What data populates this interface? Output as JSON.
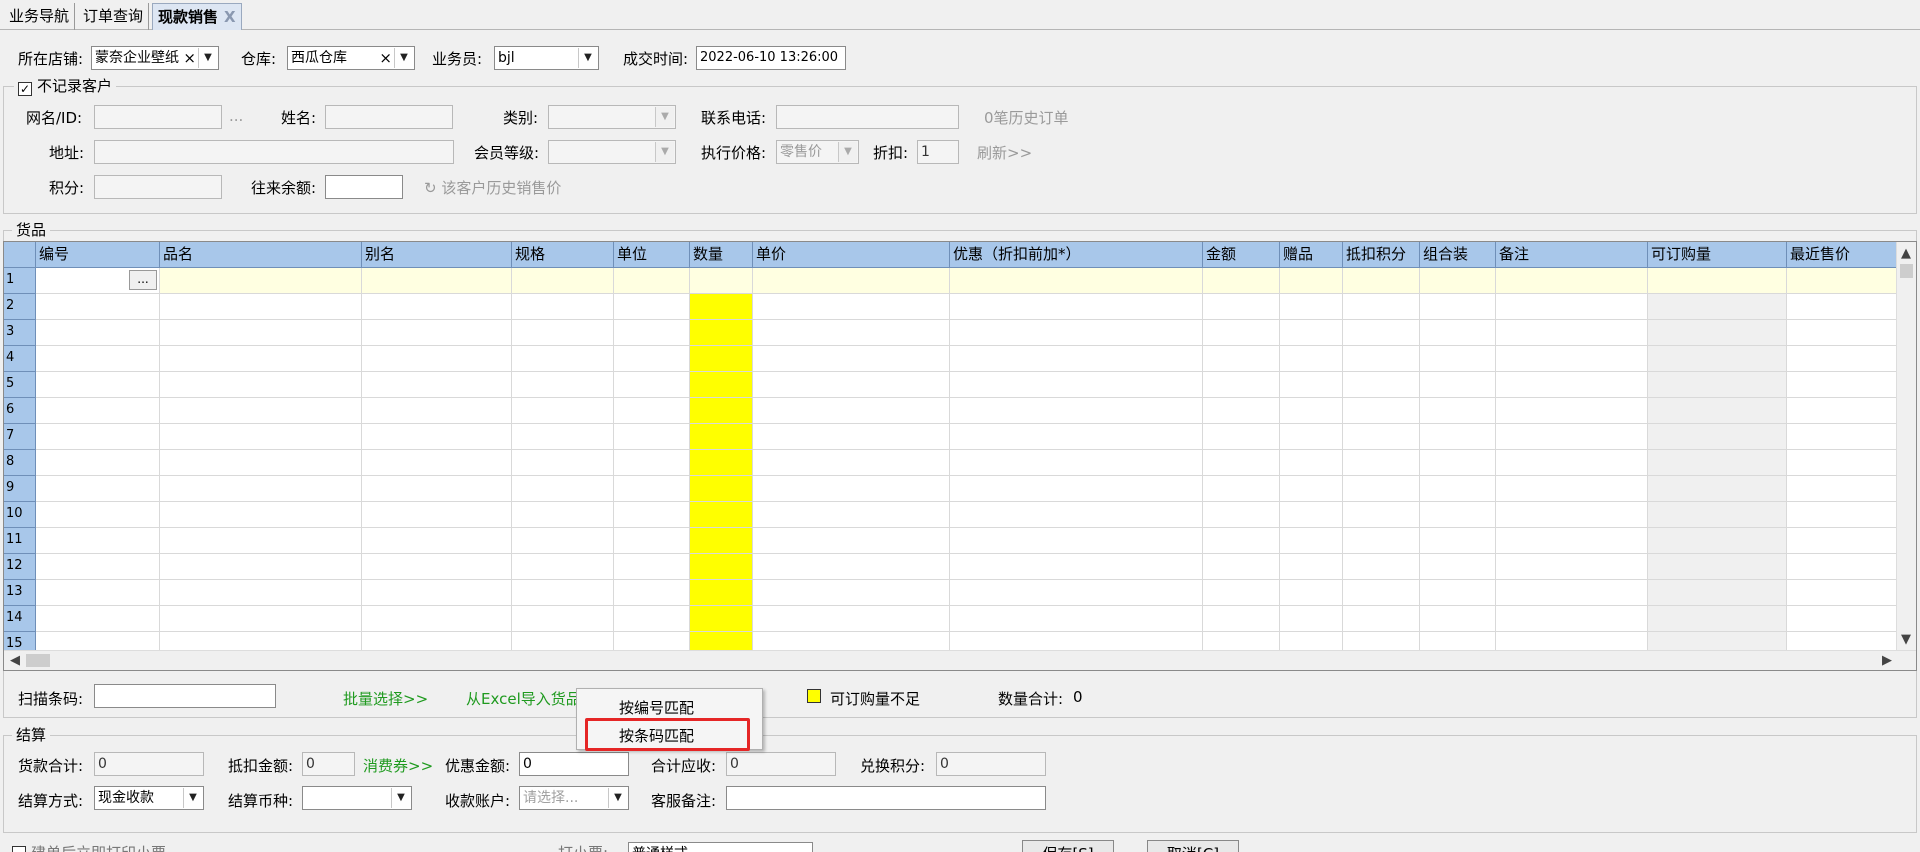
{
  "tabs": [
    {
      "label": "业务导航"
    },
    {
      "label": "订单查询"
    },
    {
      "label": "现款销售",
      "close": "X"
    }
  ],
  "header": {
    "store_label": "所在店铺:",
    "store_value": "蒙奈企业壁纸",
    "warehouse_label": "仓库:",
    "warehouse_value": "西瓜仓库",
    "salesman_label": "业务员:",
    "salesman_value": "bjl",
    "time_label": "成交时间:",
    "time_value": "2022-06-10 13:26:00"
  },
  "customer": {
    "no_record_label": "不记录客户",
    "no_record_checked": true,
    "netname_label": "网名/ID:",
    "ellipsis": "...",
    "name_label": "姓名:",
    "category_label": "类别:",
    "phone_label": "联系电话:",
    "history_orders": "0笔历史订单",
    "address_label": "地址:",
    "member_level_label": "会员等级:",
    "price_label": "执行价格:",
    "price_value": "零售价",
    "discount_label": "折扣:",
    "discount_value": "1",
    "refresh_link": "刷新>>",
    "points_label": "积分:",
    "balance_label": "往来余额:",
    "history_price_link": "该客户历史销售价"
  },
  "goods": {
    "title": "货品",
    "columns": [
      "编号",
      "品名",
      "别名",
      "规格",
      "单位",
      "数量",
      "单价",
      "优惠（折扣前加*）",
      "金额",
      "赠品",
      "抵扣积分",
      "组合装",
      "备注",
      "可订购量",
      "最近售价"
    ],
    "rows": [
      "1",
      "2",
      "3",
      "4",
      "5",
      "6",
      "7",
      "8",
      "9",
      "10",
      "11",
      "12",
      "13",
      "14",
      "15"
    ],
    "ellipsis_btn": "...",
    "scan_label": "扫描条码:",
    "batch_select": "批量选择>>",
    "import_excel": "从Excel导入货品",
    "legend_label": "可订购量不足",
    "qty_total_label": "数量合计:",
    "qty_total_value": "0"
  },
  "popup_menu": {
    "items": [
      "按编号匹配",
      "按条码匹配"
    ],
    "highlighted": "按条码匹配"
  },
  "settlement": {
    "title": "结算",
    "goods_total_label": "货款合计:",
    "goods_total_value": "0",
    "deduct_label": "抵扣金额:",
    "deduct_value": "0",
    "coupon_link": "消费券>>",
    "discount_amount_label": "优惠金额:",
    "discount_amount_value": "0",
    "receivable_label": "合计应收:",
    "receivable_value": "0",
    "exchange_points_label": "兑换积分:",
    "exchange_points_value": "0",
    "method_label": "结算方式:",
    "method_value": "现金收款",
    "currency_label": "结算币种:",
    "currency_value": "",
    "account_label": "收款账户:",
    "account_placeholder": "请选择...",
    "cs_note_label": "客服备注:"
  },
  "footer": {
    "print_after": "建单后立即打印小票",
    "print_style_label": "打小票:",
    "print_style_value": "普通样式",
    "save_button": "保存[S]",
    "cancel_button": "取消[C]"
  },
  "colors": {
    "grid_header": "#a8c7ea",
    "qty_column": "#ffff00",
    "active_row": "#ffffe1",
    "link_green": "#1f9a1f",
    "highlight_red": "#e52626"
  }
}
